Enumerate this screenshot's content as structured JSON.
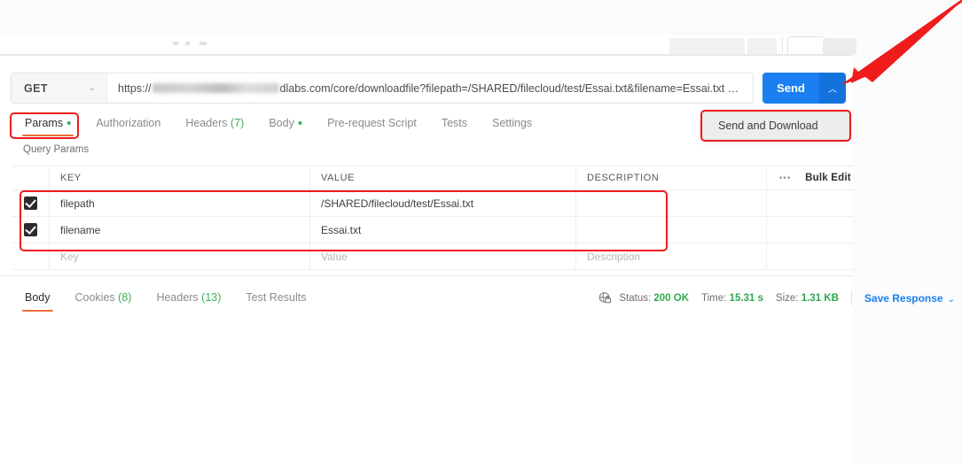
{
  "request": {
    "method": "GET",
    "method_caret_icon": "chevron-down-icon",
    "url_prefix": "https://",
    "url_redacted": true,
    "url_suffix": "dlabs.com/core/downloadfile?filepath=/SHARED/filecloud/test/Essai.txt&filename=Essai.txt …",
    "send_label": "Send",
    "send_caret_icon": "chevron-up-icon",
    "send_dropdown_item": "Send and Download",
    "accent_blue": "#1a7ff0",
    "accent_orange": "#ef6c3b"
  },
  "request_tabs": [
    {
      "label": "Params",
      "active": true,
      "dot": "•",
      "count": ""
    },
    {
      "label": "Authorization",
      "active": false,
      "dot": "",
      "count": ""
    },
    {
      "label": "Headers",
      "active": false,
      "dot": "",
      "count": "(7)"
    },
    {
      "label": "Body",
      "active": false,
      "dot": "•",
      "count": ""
    },
    {
      "label": "Pre-request Script",
      "active": false,
      "dot": "",
      "count": ""
    },
    {
      "label": "Tests",
      "active": false,
      "dot": "",
      "count": ""
    },
    {
      "label": "Settings",
      "active": false,
      "dot": "",
      "count": ""
    }
  ],
  "params": {
    "section_label": "Query Params",
    "headers": {
      "key": "KEY",
      "value": "VALUE",
      "description": "DESCRIPTION",
      "more_icon": "•••",
      "bulk_edit": "Bulk Edit"
    },
    "rows": [
      {
        "checked": true,
        "key": "filepath",
        "value": "/SHARED/filecloud/test/Essai.txt",
        "description": ""
      },
      {
        "checked": true,
        "key": "filename",
        "value": "Essai.txt",
        "description": ""
      }
    ],
    "placeholder_row": {
      "key": "Key",
      "value": "Value",
      "description": "Description"
    }
  },
  "response_tabs": [
    {
      "label": "Body",
      "active": true,
      "count": ""
    },
    {
      "label": "Cookies",
      "active": false,
      "count": "(8)"
    },
    {
      "label": "Headers",
      "active": false,
      "count": "(13)"
    },
    {
      "label": "Test Results",
      "active": false,
      "count": ""
    }
  ],
  "response_meta": {
    "secure_icon": "globe-lock-icon",
    "status_label": "Status:",
    "status_value": "200 OK",
    "time_label": "Time:",
    "time_value": "15.31 s",
    "size_label": "Size:",
    "size_value": "1.31 KB",
    "save_response": "Save Response",
    "save_caret_icon": "chevron-down-icon",
    "ok_green": "#2fa84f"
  },
  "annotations": {
    "color": "#f01b1b",
    "boxes": [
      "params-tab",
      "send-and-download",
      "query-param-rows"
    ],
    "arrow": "points-to-send-dropdown-caret"
  }
}
